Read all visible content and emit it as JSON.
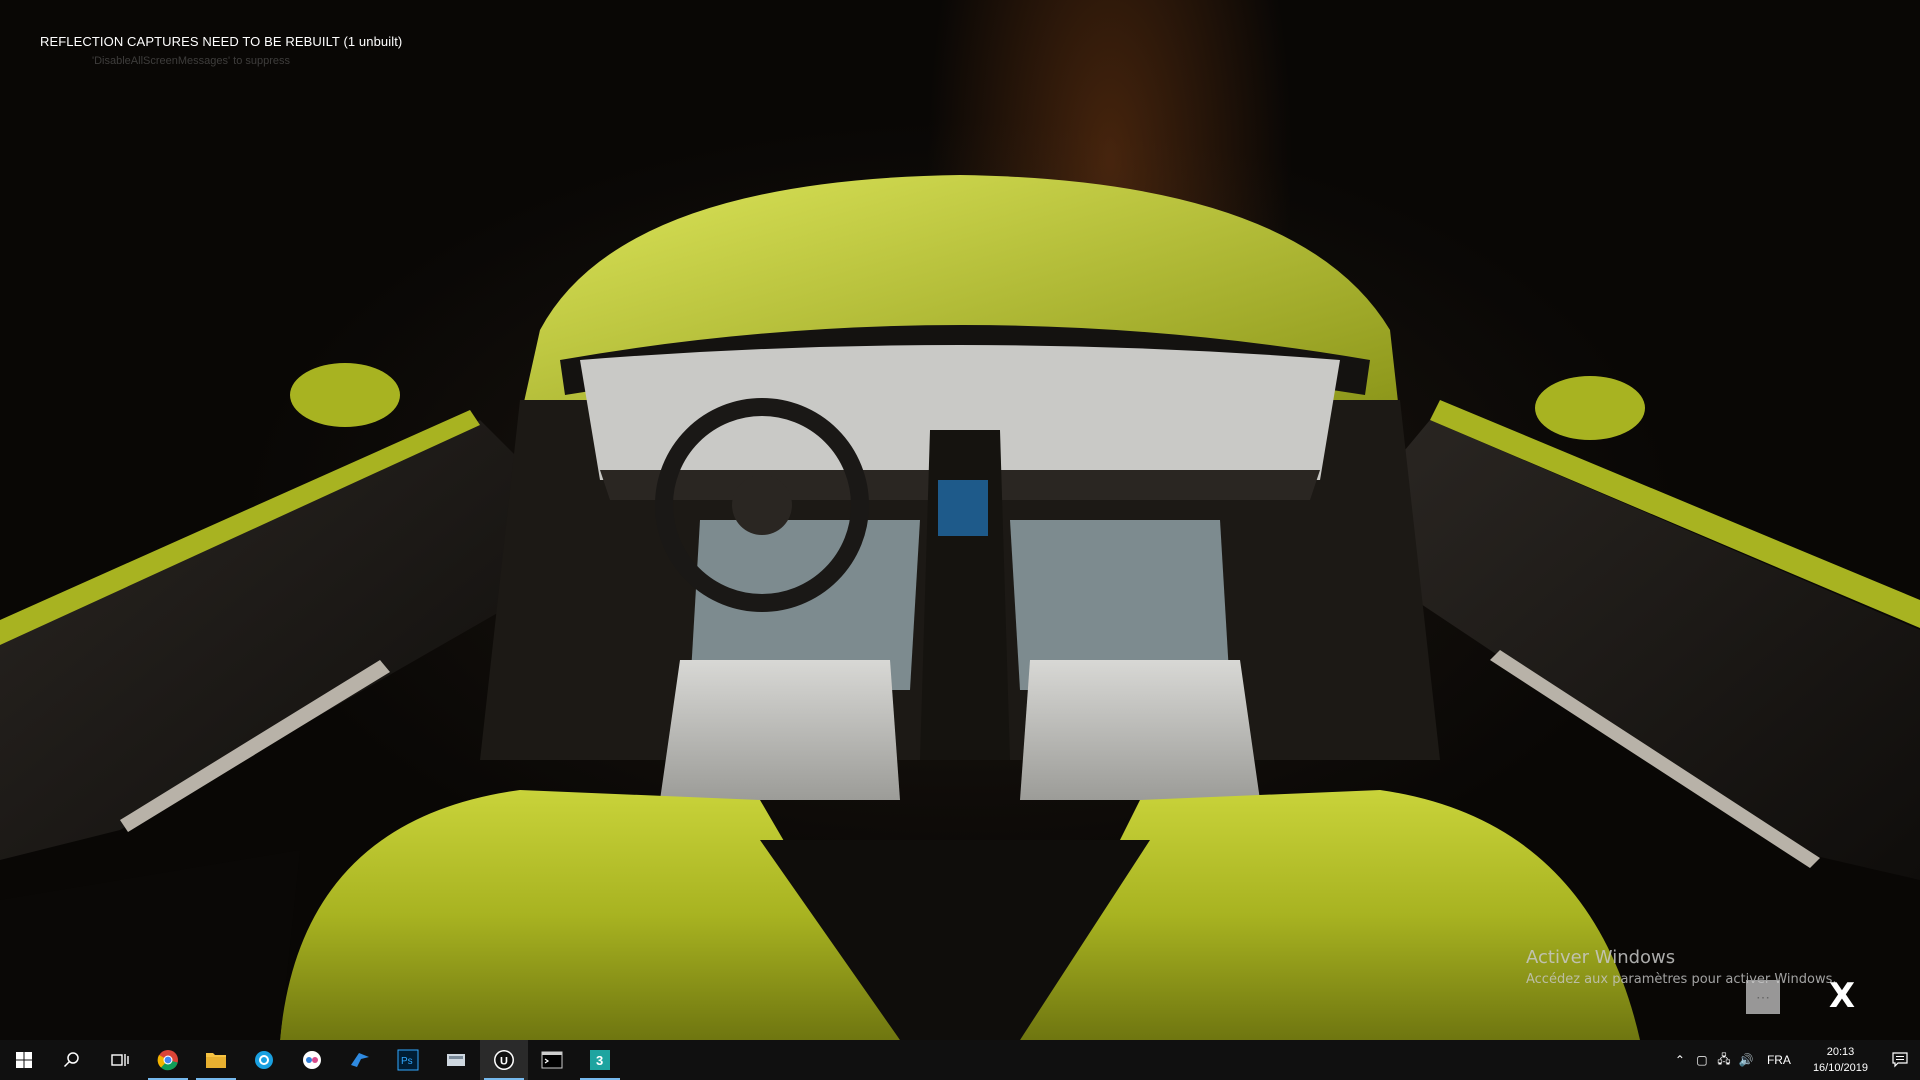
{
  "viewport": {
    "message": "REFLECTION CAPTURES NEED TO BE REBUILT (1 unbuilt)",
    "sub_message": "'DisableAllScreenMessages' to suppress",
    "scene_icon": "car-interior-render"
  },
  "watermark": {
    "title": "Activer Windows",
    "subtitle": "Accédez aux paramètres pour activer Windows."
  },
  "overlay_buttons": {
    "menu_label": "⋯",
    "close_label": "X"
  },
  "taskbar": {
    "apps": [
      {
        "name": "start",
        "icon": "windows-logo-icon"
      },
      {
        "name": "search",
        "icon": "search-icon"
      },
      {
        "name": "task-view",
        "icon": "task-view-icon"
      },
      {
        "name": "chrome",
        "icon": "chrome-icon"
      },
      {
        "name": "file-explorer",
        "icon": "folder-icon"
      },
      {
        "name": "app-blue",
        "icon": "blue-app-icon"
      },
      {
        "name": "app-cloud",
        "icon": "cloud-app-icon"
      },
      {
        "name": "app-bird",
        "icon": "bird-app-icon"
      },
      {
        "name": "photoshop",
        "icon": "photoshop-icon",
        "label": "Ps"
      },
      {
        "name": "app-drive",
        "icon": "drive-app-icon"
      },
      {
        "name": "unreal",
        "icon": "unreal-engine-icon",
        "label": "U"
      },
      {
        "name": "terminal",
        "icon": "terminal-icon"
      },
      {
        "name": "3dsmax",
        "icon": "3dsmax-icon",
        "label": "3"
      }
    ],
    "tray": {
      "language": "FRA",
      "time": "20:13",
      "date": "16/10/2019"
    }
  },
  "colors": {
    "car_body": "#b5c22a",
    "interior_light": "#c8c8c6",
    "taskbar_bg": "#101010",
    "active_indicator": "#76b9ed"
  }
}
